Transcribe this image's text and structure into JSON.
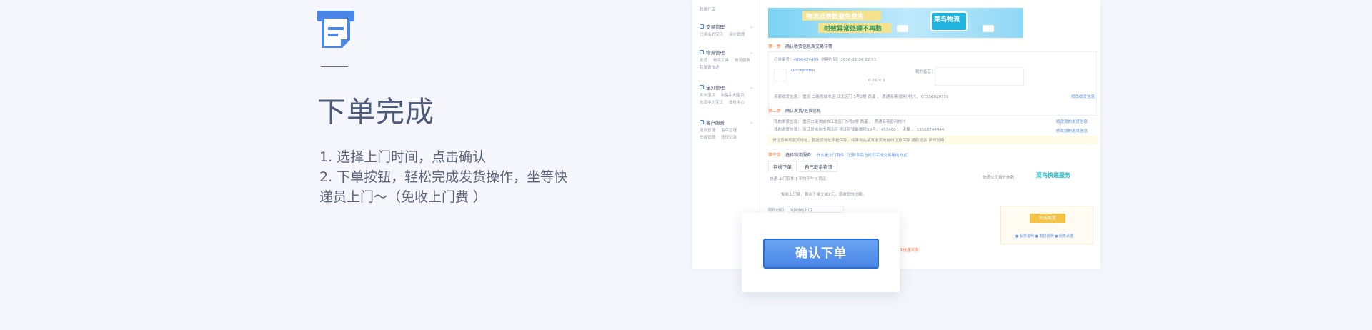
{
  "intro": {
    "icon": "document-icon",
    "title": "下单完成",
    "step1": "1. 选择上门时间，点击确认",
    "step2": "2. 下单按钮，轻松完成发货操作，坐等快递员上门～（免收上门费 ）"
  },
  "shot": {
    "sidebar": [
      {
        "title": "交易管理",
        "links": [
          "已卖出的宝贝",
          "评价管理"
        ]
      },
      {
        "title": "物流管理",
        "links": [
          "发货",
          "物流工具",
          "物流服务",
          "我要寄快递"
        ]
      },
      {
        "title": "宝贝管理",
        "links": [
          "发布宝贝",
          "出售中的宝贝",
          "仓库中的宝贝",
          "体检中心"
        ]
      },
      {
        "title": "客户服务",
        "links": [
          "退款管理",
          "售后管理",
          "举报管理",
          "违规记录"
        ]
      }
    ],
    "top_link": "我要开店",
    "banner": {
      "line1": "物流运费数据免费用",
      "line2": "时效异常处理不再愁",
      "pill": "菜鸟物流"
    },
    "step_one": {
      "tag": "第一步",
      "title": "确认收货信息及交易详情"
    },
    "order_no_label": "订单编号：",
    "order_no": "4096424499",
    "created_label": "创建时间：",
    "created": "2016-11-26 22:53",
    "item_link": "Quickprobm",
    "item_price": "0.00 × 1",
    "note_label": "我的备忘：",
    "buyer_address": "买家收货信息： 重庆 二级类城市区 江北区门  5号2幢 西溪 ， 质通名蒋 欧利 村村，  07556920759",
    "modify_buyer": "修改收货信息",
    "step_two": {
      "tag": "第二步",
      "title": "确认发货/退货信息"
    },
    "ship_info": "我的发货信息：  重庆二级类城市江北区门5号2幢 西溪 ，  质通名蒋欧利村村",
    "return_info": "我的退货信息：  浙江省杭州市滨江区 滨江区智能数控99号，  453400 ，  天猫  ，  13568744944",
    "modify_ship": "修改我的发货信息",
    "modify_return": "修改我的退货信息",
    "warning": "请注意确写退货地址，若退货地址不是保存，如果你在填写退货地址时注意保存 退款提示 详细说明",
    "step_three": {
      "tag": "第三步",
      "title": "选择物流服务"
    },
    "step_three_hint": "什么是上门取件（已联系后当时可完成交易用的方式）",
    "tabs": [
      "在线下单",
      "自己联系物流"
    ],
    "service_opts": "快递   上门取件 ( 平均下午 )    货运",
    "quote": "快递公司报价参数",
    "cainiao": "菜鸟快递服务",
    "free_pickup": "免收上门费，首次下单立减2元，感谢您的信赖。",
    "time_label": "取件时间：",
    "time_value": "2小时内上门",
    "panel_btn": "完成取货",
    "panel_links": "● 服务说明  ● 发送说明  ● 服务承诺",
    "bottom_note": "全国范围内单件快递不限"
  },
  "confirm": {
    "button_label": "确认下单"
  }
}
